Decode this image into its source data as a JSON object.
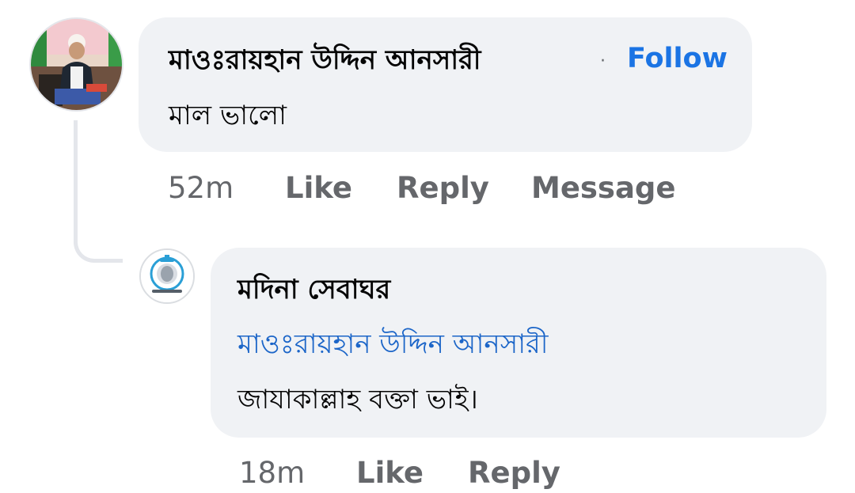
{
  "comment": {
    "author": "মাওঃরায়হান উদ্দিন আনসারী",
    "separator": "·",
    "follow_label": "Follow",
    "text": "মাল ভালো",
    "time": "52m",
    "like_label": "Like",
    "reply_label": "Reply",
    "message_label": "Message"
  },
  "reply": {
    "author": "মদিনা সেবাঘর",
    "mention": "মাওঃরায়হান উদ্দিন আনসারী",
    "text": "জাযাকাল্লাহ বক্তা ভাই।",
    "time": "18m",
    "like_label": "Like",
    "reply_label": "Reply"
  },
  "colors": {
    "bubble": "#f0f2f5",
    "link": "#1b74e4",
    "secondary_text": "#65676b",
    "thread_line": "#e4e6eb"
  }
}
